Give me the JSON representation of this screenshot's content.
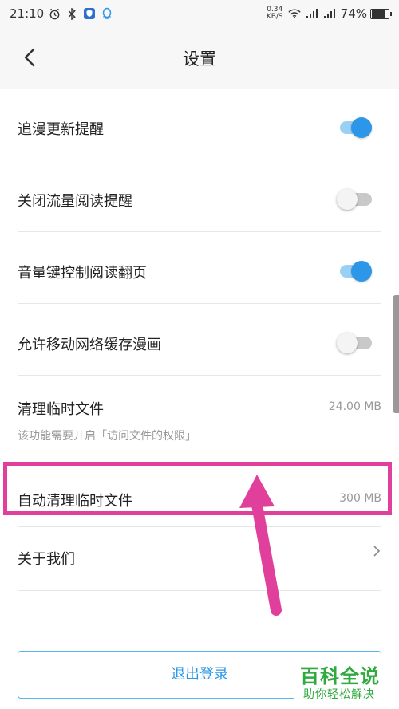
{
  "status_bar": {
    "time": "21:10",
    "speed_value": "0.34",
    "speed_unit": "KB/S",
    "battery": "74%",
    "icons": [
      "alarm-icon",
      "bluetooth-icon",
      "shield-icon",
      "qq-icon",
      "wifi-icon",
      "signal-icon",
      "signal-4g-icon",
      "battery-icon"
    ]
  },
  "header": {
    "title": "设置",
    "back_icon": "chevron-left-icon"
  },
  "settings": {
    "items": [
      {
        "label": "追漫更新提醒",
        "type": "toggle",
        "on": true
      },
      {
        "label": "关闭流量阅读提醒",
        "type": "toggle",
        "on": false
      },
      {
        "label": "音量键控制阅读翻页",
        "type": "toggle",
        "on": true
      },
      {
        "label": "允许移动网络缓存漫画",
        "type": "toggle",
        "on": false
      },
      {
        "label": "清理临时文件",
        "sub": "该功能需要开启「访问文件的权限」",
        "value": "24.00 MB"
      },
      {
        "label": "自动清理临时文件",
        "value": "300 MB"
      },
      {
        "label": "关于我们",
        "type": "link"
      }
    ]
  },
  "footer": {
    "logout_label": "退出登录"
  },
  "watermark": {
    "title": "百科全说",
    "subtitle": "助你轻松解决"
  },
  "colors": {
    "accent": "#2c97e8",
    "highlight": "#e0409b",
    "watermark": "#2eaa3e"
  }
}
